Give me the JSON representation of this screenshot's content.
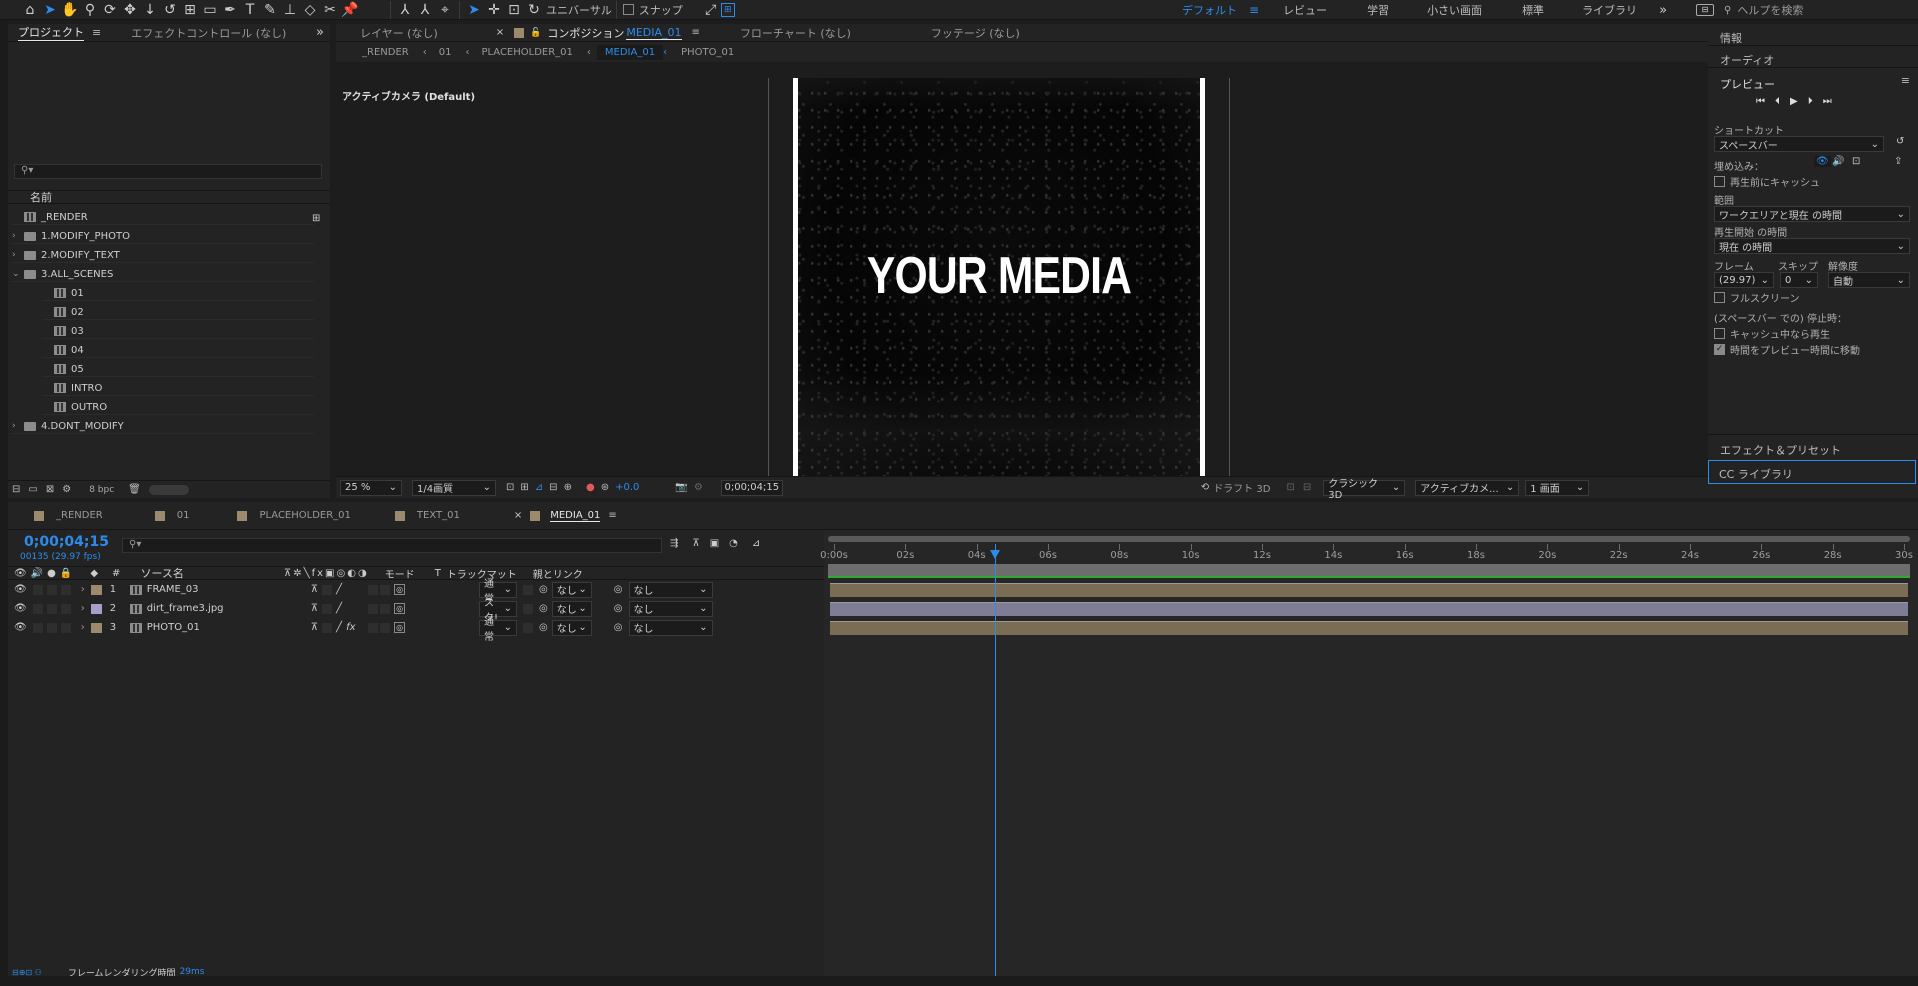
{
  "toolbar": {
    "snap_label": "スナップ",
    "universal_label": "ユニバーサル",
    "workspaces": [
      "デフォルト",
      "レビュー",
      "学習",
      "小さい画面",
      "標準",
      "ライブラリ"
    ],
    "active_workspace": "デフォルト",
    "help_placeholder": "ヘルプを検索"
  },
  "project_panel": {
    "tabs": [
      "プロジェクト",
      "エフェクトコントロール (なし)"
    ],
    "name_header": "名前",
    "bpc": "8 bpc",
    "items": [
      {
        "label": "_RENDER",
        "type": "comp",
        "depth": 0
      },
      {
        "label": "1.MODIFY_PHOTO",
        "type": "folder",
        "depth": 0
      },
      {
        "label": "2.MODIFY_TEXT",
        "type": "folder",
        "depth": 0
      },
      {
        "label": "3.ALL_SCENES",
        "type": "folder",
        "depth": 0,
        "open": true
      },
      {
        "label": "01",
        "type": "comp",
        "depth": 1
      },
      {
        "label": "02",
        "type": "comp",
        "depth": 1
      },
      {
        "label": "03",
        "type": "comp",
        "depth": 1
      },
      {
        "label": "04",
        "type": "comp",
        "depth": 1
      },
      {
        "label": "05",
        "type": "comp",
        "depth": 1
      },
      {
        "label": "INTRO",
        "type": "comp",
        "depth": 1
      },
      {
        "label": "OUTRO",
        "type": "comp",
        "depth": 1
      },
      {
        "label": "4.DONT_MODIFY",
        "type": "folder",
        "depth": 0
      }
    ]
  },
  "viewer": {
    "tabs": [
      {
        "label": "レイヤー (なし)"
      },
      {
        "label": "コンポジション",
        "suffix": "MEDIA_01"
      },
      {
        "label": "フローチャート (なし)"
      },
      {
        "label": "フッテージ (なし)"
      }
    ],
    "breadcrumbs": [
      "_RENDER",
      "01",
      "PLACEHOLDER_01",
      "MEDIA_01",
      "PHOTO_01"
    ],
    "active_breadcrumb": "MEDIA_01",
    "camera_label": "アクティブカメラ (Default)",
    "media_text": "YOUR MEDIA",
    "footer": {
      "zoom": "25 %",
      "quality": "1/4画質",
      "exposure": "+0.0",
      "timecode": "0;00;04;15",
      "draft3d": "ドラフト 3D",
      "renderer": "クラシック3D",
      "camera": "アクティブカメ...",
      "views": "1 画面"
    }
  },
  "right_panel": {
    "info": "情報",
    "audio": "オーディオ",
    "preview": "プレビュー",
    "shortcut_label": "ショートカット",
    "shortcut_value": "スペースバー",
    "embed_label": "埋め込み：",
    "cache_before": "再生前にキャッシュ",
    "range_label": "範囲",
    "range_value": "ワークエリアと現在 の時間",
    "start_label": "再生開始 の時間",
    "start_value": "現在 の時間",
    "frame_label": "フレーム",
    "skip_label": "スキップ",
    "res_label": "解像度",
    "frame_value": "(29.97)",
    "skip_value": "0",
    "res_value": "自動",
    "fullscreen": "フルスクリーン",
    "stop_label": "(スペースバー での) 停止時：",
    "cache_play": "キャッシュ中なら再生",
    "move_time": "時間をプレビュー時間に移動",
    "effects": "エフェクト＆プリセット",
    "cc": "CC ライブラリ"
  },
  "timeline": {
    "tabs": [
      {
        "label": "_RENDER",
        "color": "#9b8a6b"
      },
      {
        "label": "01",
        "color": "#9b8a6b"
      },
      {
        "label": "PLACEHOLDER_01",
        "color": "#9b8a6b"
      },
      {
        "label": "TEXT_01",
        "color": "#9b8a6b"
      },
      {
        "label": "MEDIA_01",
        "color": "#9b8a6b"
      }
    ],
    "active_tab": "MEDIA_01",
    "timecode": "0;00;04;15",
    "frames": "00135 (29.97 fps)",
    "headers": {
      "num": "#",
      "source": "ソース名",
      "mode": "モード",
      "t": "T",
      "trackmatte": "トラックマット",
      "parent": "親とリンク"
    },
    "ruler": [
      "0:00s",
      "02s",
      "04s",
      "06s",
      "08s",
      "10s",
      "12s",
      "14s",
      "16s",
      "18s",
      "20s",
      "22s",
      "24s",
      "26s",
      "28s",
      "30s"
    ],
    "playhead_seconds": 4.5,
    "duration_seconds": 30,
    "layers": [
      {
        "num": "1",
        "name": "FRAME_03",
        "color": "#9b8a6b",
        "mode": "通常",
        "matte": "なし",
        "parent": "なし",
        "bar_color": "#7b6c54"
      },
      {
        "num": "2",
        "name": "dirt_frame3.jpg",
        "color": "#a6a0c9",
        "mode": "スク!",
        "matte": "なし",
        "parent": "なし",
        "bar_color": "#7f7c96"
      },
      {
        "num": "3",
        "name": "PHOTO_01",
        "color": "#9b8a6b",
        "mode": "通常",
        "matte": "なし",
        "parent": "なし",
        "bar_color": "#7b6c54"
      }
    ],
    "status": "フレームレンダリング時間",
    "status_value": "29ms"
  }
}
